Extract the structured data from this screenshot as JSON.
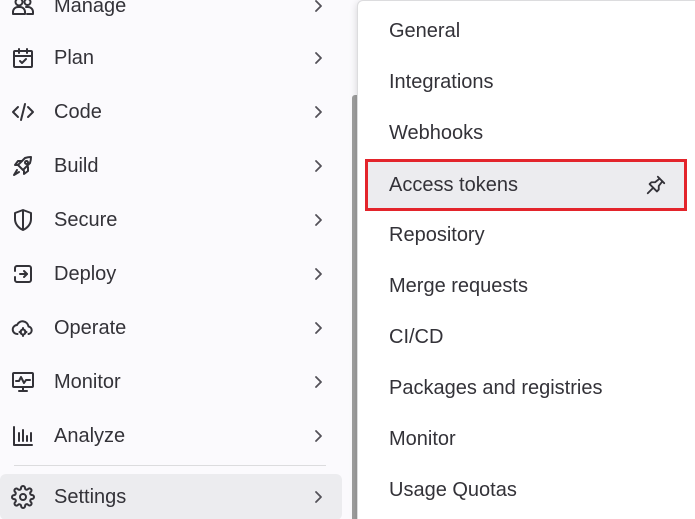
{
  "sidebar": {
    "items": [
      {
        "label": "Manage",
        "icon": "users-icon"
      },
      {
        "label": "Plan",
        "icon": "calendar-icon"
      },
      {
        "label": "Code",
        "icon": "code-icon"
      },
      {
        "label": "Build",
        "icon": "rocket-icon"
      },
      {
        "label": "Secure",
        "icon": "shield-icon"
      },
      {
        "label": "Deploy",
        "icon": "deploy-icon"
      },
      {
        "label": "Operate",
        "icon": "cloud-gear-icon"
      },
      {
        "label": "Monitor",
        "icon": "monitor-icon"
      },
      {
        "label": "Analyze",
        "icon": "chart-icon"
      },
      {
        "label": "Settings",
        "icon": "gear-icon",
        "active": true
      }
    ]
  },
  "settings_flyout": {
    "items": [
      {
        "label": "General"
      },
      {
        "label": "Integrations"
      },
      {
        "label": "Webhooks"
      },
      {
        "label": "Access tokens",
        "highlighted": true,
        "pin_icon": "pin-icon"
      },
      {
        "label": "Repository"
      },
      {
        "label": "Merge requests"
      },
      {
        "label": "CI/CD"
      },
      {
        "label": "Packages and registries"
      },
      {
        "label": "Monitor"
      },
      {
        "label": "Usage Quotas"
      }
    ]
  },
  "colors": {
    "sidebar_background": "#fbfafd",
    "active_item_background": "#ececef",
    "highlight_outline": "#e3242b",
    "text": "#333238"
  }
}
